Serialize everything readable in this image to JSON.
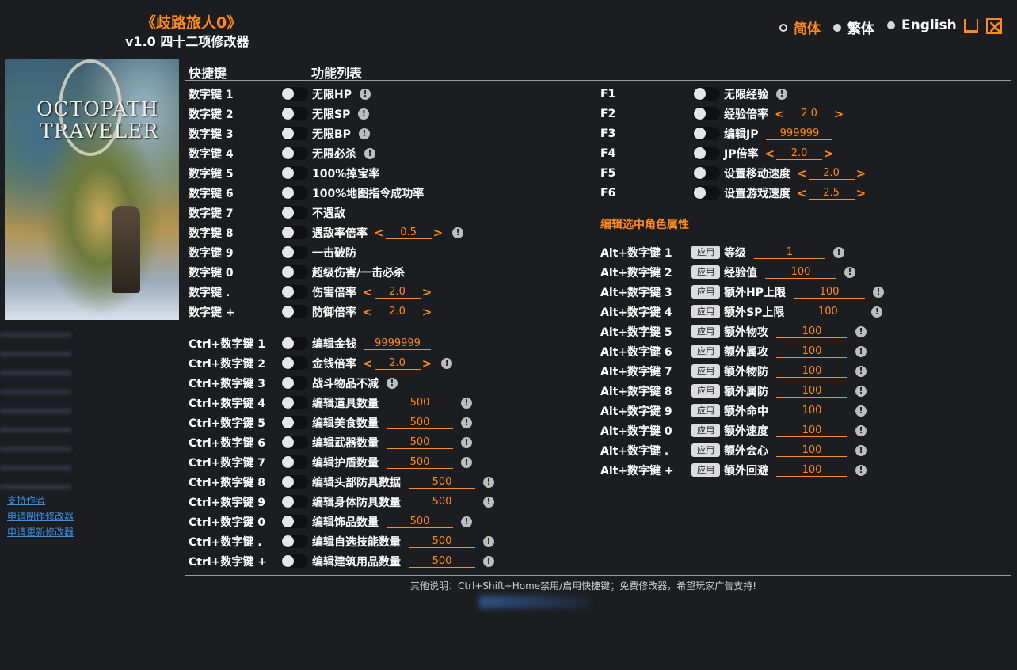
{
  "header": {
    "title": "《歧路旅人0》",
    "subtitle": "v1.0 四十二项修改器"
  },
  "languages": [
    {
      "label": "简体",
      "active": true
    },
    {
      "label": "繁体",
      "active": false
    },
    {
      "label": "English",
      "active": false
    }
  ],
  "cover": {
    "line1": "OCTOPATH",
    "line2": "TRAVELER"
  },
  "side_links": [
    "支持作者",
    "申请制作修改器",
    "申请更新修改器"
  ],
  "columns": {
    "hotkey": "快捷键",
    "features": "功能列表"
  },
  "apply_label": "应用",
  "left_features": [
    {
      "key": "数字键 1",
      "label": "无限HP",
      "info": true
    },
    {
      "key": "数字键 2",
      "label": "无限SP",
      "info": true
    },
    {
      "key": "数字键 3",
      "label": "无限BP",
      "info": true
    },
    {
      "key": "数字键 4",
      "label": "无限必杀",
      "info": true
    },
    {
      "key": "数字键 5",
      "label": "100%掉宝率"
    },
    {
      "key": "数字键 6",
      "label": "100%地图指令成功率"
    },
    {
      "key": "数字键 7",
      "label": "不遇敌"
    },
    {
      "key": "数字键 8",
      "label": "遇敌率倍率",
      "value": "0.5",
      "stepper": true,
      "info": true
    },
    {
      "key": "数字键 9",
      "label": "一击破防"
    },
    {
      "key": "数字键 0",
      "label": "超级伤害/一击必杀"
    },
    {
      "key": "数字键 .",
      "label": "伤害倍率",
      "value": "2.0",
      "stepper": true
    },
    {
      "key": "数字键 +",
      "label": "防御倍率",
      "value": "2.0",
      "stepper": true
    },
    {
      "key": "Ctrl+数字键 1",
      "label": "编辑金钱",
      "value": "9999999"
    },
    {
      "key": "Ctrl+数字键 2",
      "label": "金钱倍率",
      "value": "2.0",
      "stepper": true,
      "info": true
    },
    {
      "key": "Ctrl+数字键 3",
      "label": "战斗物品不减",
      "info": true
    },
    {
      "key": "Ctrl+数字键 4",
      "label": "编辑道具数量",
      "value": "500",
      "info": true
    },
    {
      "key": "Ctrl+数字键 5",
      "label": "编辑美食数量",
      "value": "500",
      "info": true
    },
    {
      "key": "Ctrl+数字键 6",
      "label": "编辑武器数量",
      "value": "500",
      "info": true
    },
    {
      "key": "Ctrl+数字键 7",
      "label": "编辑护盾数量",
      "value": "500",
      "info": true
    },
    {
      "key": "Ctrl+数字键 8",
      "label": "编辑头部防具数据",
      "value": "500",
      "info": true
    },
    {
      "key": "Ctrl+数字键 9",
      "label": "编辑身体防具数量",
      "value": "500",
      "info": true
    },
    {
      "key": "Ctrl+数字键 0",
      "label": "编辑饰品数量",
      "value": "500",
      "info": true
    },
    {
      "key": "Ctrl+数字键 .",
      "label": "编辑自选技能数量",
      "value": "500",
      "info": true
    },
    {
      "key": "Ctrl+数字键 +",
      "label": "编辑建筑用品数量",
      "value": "500",
      "info": true
    }
  ],
  "right_features": [
    {
      "key": "F1",
      "label": "无限经验",
      "info": true
    },
    {
      "key": "F2",
      "label": "经验倍率",
      "value": "2.0",
      "stepper": true
    },
    {
      "key": "F3",
      "label": "编辑JP",
      "value": "999999"
    },
    {
      "key": "F4",
      "label": "JP倍率",
      "value": "2.0",
      "stepper": true
    },
    {
      "key": "F5",
      "label": "设置移动速度",
      "value": "2.0",
      "stepper": true
    },
    {
      "key": "F6",
      "label": "设置游戏速度",
      "value": "2.5",
      "stepper": true
    }
  ],
  "char_section_title": "编辑选中角色属性",
  "char_features": [
    {
      "key": "Alt+数字键 1",
      "label": "等级",
      "value": "1"
    },
    {
      "key": "Alt+数字键 2",
      "label": "经验值",
      "value": "100"
    },
    {
      "key": "Alt+数字键 3",
      "label": "额外HP上限",
      "value": "100"
    },
    {
      "key": "Alt+数字键 4",
      "label": "额外SP上限",
      "value": "100"
    },
    {
      "key": "Alt+数字键 5",
      "label": "额外物攻",
      "value": "100"
    },
    {
      "key": "Alt+数字键 6",
      "label": "额外属攻",
      "value": "100"
    },
    {
      "key": "Alt+数字键 7",
      "label": "额外物防",
      "value": "100"
    },
    {
      "key": "Alt+数字键 8",
      "label": "额外属防",
      "value": "100"
    },
    {
      "key": "Alt+数字键 9",
      "label": "额外命中",
      "value": "100"
    },
    {
      "key": "Alt+数字键 0",
      "label": "额外速度",
      "value": "100"
    },
    {
      "key": "Alt+数字键 .",
      "label": "额外会心",
      "value": "100"
    },
    {
      "key": "Alt+数字键 +",
      "label": "额外回避",
      "value": "100"
    }
  ],
  "footer": "其他说明：Ctrl+Shift+Home禁用/启用快捷键；免费修改器，希望玩家广告支持!",
  "colors": {
    "accent": "#ff8a1f",
    "background": "#1c1d20",
    "link": "#3d8ee0"
  }
}
